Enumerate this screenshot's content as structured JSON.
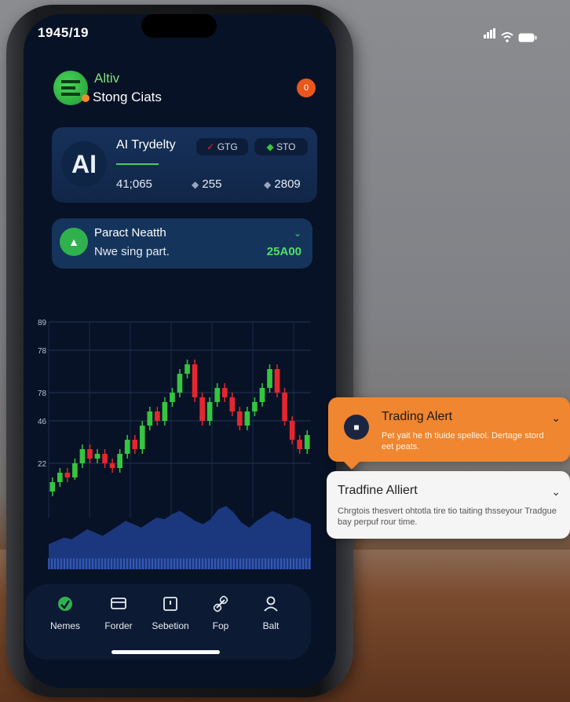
{
  "status": {
    "time": "1945/19"
  },
  "header": {
    "brand": "Altiv",
    "subtitle": "Stong Ciats",
    "notification_badge": "0"
  },
  "card_ai": {
    "avatar": "AI",
    "title": "AI Trydelty",
    "pill_left": "GTG",
    "pill_right": "STO",
    "value_main": "41;065",
    "value_mid": "255",
    "value_right": "2809"
  },
  "card_health": {
    "title": "Paract Neatth",
    "subtitle": "Nwe sing part.",
    "value": "25A00"
  },
  "chart_data": {
    "type": "candlestick",
    "y_tick_labels": [
      "89",
      "78",
      "78",
      "46",
      "22"
    ],
    "colors": {
      "up": "#35c53f",
      "down": "#e4262e",
      "volume": "#1f3f8f"
    },
    "candles": [
      {
        "open": 18,
        "close": 22,
        "high": 24,
        "low": 16
      },
      {
        "open": 22,
        "close": 26,
        "high": 28,
        "low": 20
      },
      {
        "open": 26,
        "close": 24,
        "high": 28,
        "low": 22
      },
      {
        "open": 24,
        "close": 30,
        "high": 32,
        "low": 23
      },
      {
        "open": 30,
        "close": 36,
        "high": 38,
        "low": 28
      },
      {
        "open": 36,
        "close": 32,
        "high": 38,
        "low": 30
      },
      {
        "open": 32,
        "close": 34,
        "high": 36,
        "low": 30
      },
      {
        "open": 34,
        "close": 30,
        "high": 36,
        "low": 28
      },
      {
        "open": 30,
        "close": 28,
        "high": 32,
        "low": 26
      },
      {
        "open": 28,
        "close": 34,
        "high": 36,
        "low": 26
      },
      {
        "open": 34,
        "close": 40,
        "high": 42,
        "low": 32
      },
      {
        "open": 40,
        "close": 36,
        "high": 42,
        "low": 34
      },
      {
        "open": 36,
        "close": 46,
        "high": 48,
        "low": 34
      },
      {
        "open": 46,
        "close": 52,
        "high": 54,
        "low": 44
      },
      {
        "open": 52,
        "close": 48,
        "high": 54,
        "low": 46
      },
      {
        "open": 48,
        "close": 56,
        "high": 58,
        "low": 46
      },
      {
        "open": 56,
        "close": 60,
        "high": 62,
        "low": 54
      },
      {
        "open": 60,
        "close": 68,
        "high": 70,
        "low": 58
      },
      {
        "open": 68,
        "close": 72,
        "high": 74,
        "low": 66
      },
      {
        "open": 72,
        "close": 58,
        "high": 74,
        "low": 56
      },
      {
        "open": 58,
        "close": 48,
        "high": 60,
        "low": 46
      },
      {
        "open": 48,
        "close": 56,
        "high": 58,
        "low": 46
      },
      {
        "open": 56,
        "close": 62,
        "high": 64,
        "low": 54
      },
      {
        "open": 62,
        "close": 58,
        "high": 64,
        "low": 56
      },
      {
        "open": 58,
        "close": 52,
        "high": 60,
        "low": 50
      },
      {
        "open": 52,
        "close": 46,
        "high": 54,
        "low": 44
      },
      {
        "open": 46,
        "close": 52,
        "high": 54,
        "low": 44
      },
      {
        "open": 52,
        "close": 56,
        "high": 58,
        "low": 50
      },
      {
        "open": 56,
        "close": 62,
        "high": 64,
        "low": 54
      },
      {
        "open": 62,
        "close": 70,
        "high": 72,
        "low": 60
      },
      {
        "open": 70,
        "close": 60,
        "high": 72,
        "low": 58
      },
      {
        "open": 60,
        "close": 48,
        "high": 62,
        "low": 46
      },
      {
        "open": 48,
        "close": 40,
        "high": 50,
        "low": 38
      },
      {
        "open": 40,
        "close": 36,
        "high": 42,
        "low": 34
      },
      {
        "open": 36,
        "close": 42,
        "high": 44,
        "low": 34
      }
    ],
    "volume": [
      30,
      34,
      38,
      36,
      42,
      48,
      44,
      40,
      46,
      52,
      58,
      54,
      50,
      56,
      62,
      60,
      66,
      70,
      64,
      58,
      54,
      60,
      72,
      76,
      68,
      56,
      50,
      58,
      64,
      70,
      66,
      60,
      62,
      58,
      54
    ]
  },
  "tabs": [
    {
      "label": "Nemes"
    },
    {
      "label": "Forder"
    },
    {
      "label": "Sebetion"
    },
    {
      "label": "Fop"
    },
    {
      "label": "Balt"
    }
  ],
  "alert_orange": {
    "title": "Trading Alert",
    "text": "Pet yait he th tiuide spelleol. Dertage stord eet peats."
  },
  "alert_white": {
    "title": "Tradfine Alliert",
    "text": "Chrgtois thesvert ohtotla tire tio taiting thsseyour Tradgue bay perpuf rour time."
  }
}
